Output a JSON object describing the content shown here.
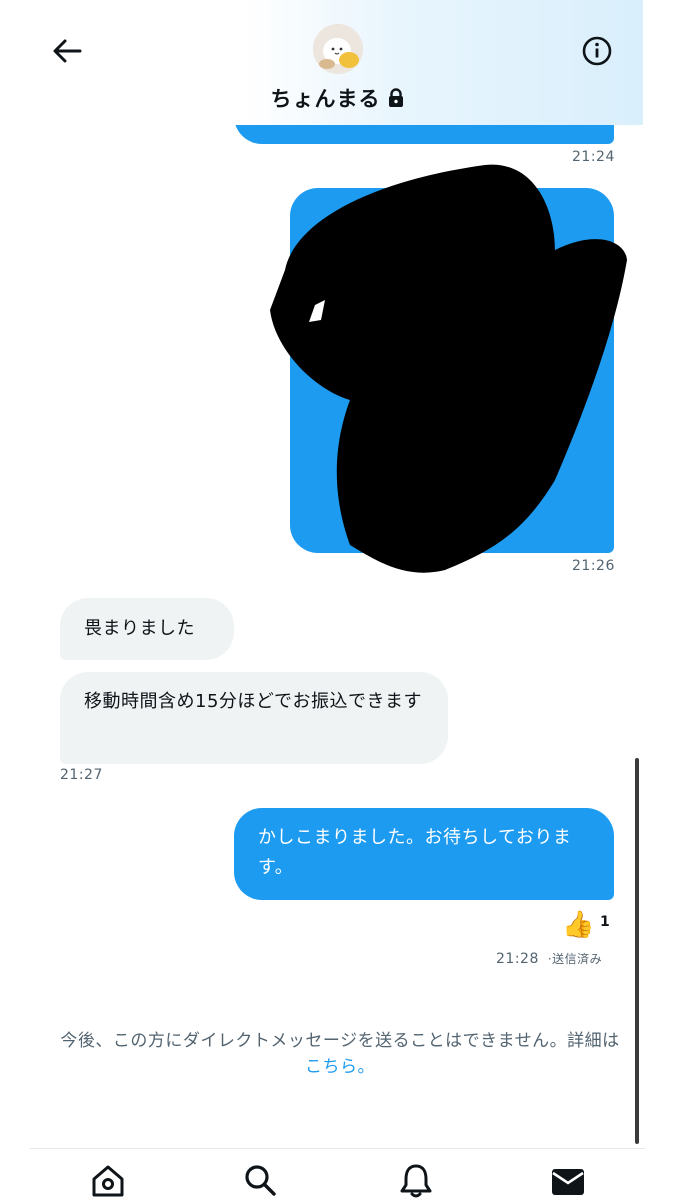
{
  "header": {
    "title": "ちょんまる",
    "back_icon": "arrow-left-icon",
    "info_icon": "info-circle-icon",
    "lock_icon": "lock-icon"
  },
  "messages": {
    "out_1_time": "21:24",
    "out_2_time": "21:26",
    "in_1_text": "畏まりました",
    "in_2_text": "移動時間含め15分ほどでお振込できます",
    "in_time": "21:27",
    "out_3_text": "かしこまりました。お待ちしております。",
    "reaction_emoji": "👍",
    "reaction_count": "1",
    "out_3_time": "21:28",
    "out_3_status": "·送信済み"
  },
  "notice": {
    "text": "今後、この方にダイレクトメッセージを送ることはできません。詳細は",
    "link": "こちら。"
  },
  "bottom_nav": {
    "home_icon": "home-icon",
    "search_icon": "search-icon",
    "notifications_icon": "bell-icon",
    "messages_icon": "envelope-icon"
  },
  "colors": {
    "accent": "#1d9bf0",
    "incoming_bubble": "#eff3f4",
    "muted_text": "#536471"
  }
}
